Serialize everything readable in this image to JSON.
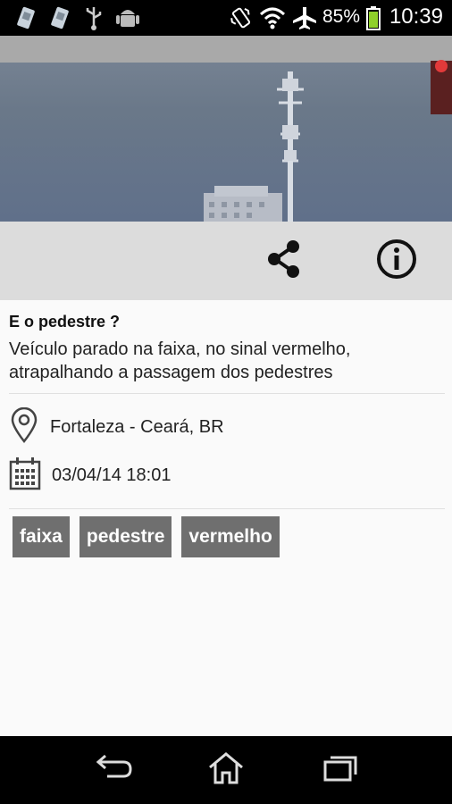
{
  "status_bar": {
    "battery": "85%",
    "time": "10:39",
    "icons": [
      "sim-card-icon",
      "sim-card-icon",
      "usb-icon",
      "android-icon",
      "vibrate-icon",
      "wifi-icon",
      "airplane-icon",
      "battery-icon"
    ]
  },
  "actions": {
    "share_icon": "share-icon",
    "info_icon": "info-icon"
  },
  "report": {
    "title": "E o pedestre ?",
    "description": "Veículo parado na faixa, no sinal vermelho, atrapalhando a passagem dos pedestres",
    "location": "Fortaleza - Ceará, BR",
    "datetime": "03/04/14 18:01",
    "tags": [
      "faixa",
      "pedestre",
      "vermelho"
    ]
  },
  "nav": {
    "back_icon": "back-icon",
    "home_icon": "home-icon",
    "recents_icon": "recents-icon"
  },
  "colors": {
    "status_bar": "#000000",
    "action_bar": "#dcdcdc",
    "tag_bg": "#6f6f6f",
    "nav_bar": "#000000"
  }
}
